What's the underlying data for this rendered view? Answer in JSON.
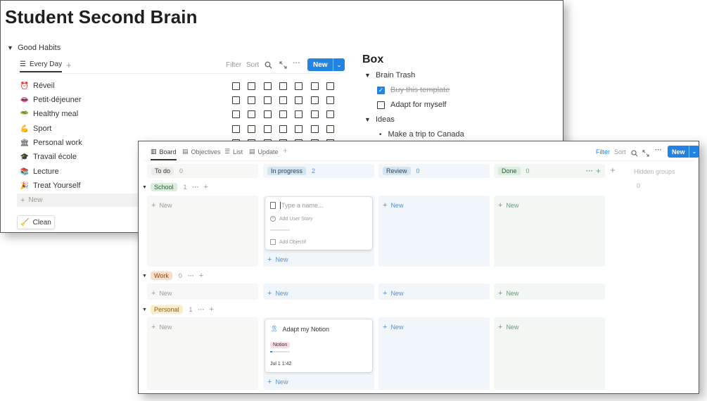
{
  "page": {
    "title": "Student Second Brain"
  },
  "habits": {
    "section_label": "Good Habits",
    "tab_label": "Every Day",
    "toolbar": {
      "filter": "Filter",
      "sort": "Sort",
      "new": "New"
    },
    "items": [
      {
        "label": "Réveil",
        "icon": "alarm-clock-icon",
        "glyph": "⏰"
      },
      {
        "label": "Petit-déjeuner",
        "icon": "lips-icon",
        "glyph": "👄"
      },
      {
        "label": "Healthy meal",
        "icon": "salad-icon",
        "glyph": "🥗"
      },
      {
        "label": "Sport",
        "icon": "flexed-biceps-icon",
        "glyph": "💪"
      },
      {
        "label": "Personal work",
        "icon": "bank-icon",
        "glyph": "🏛"
      },
      {
        "label": "Travail école",
        "icon": "graduation-cap-icon",
        "glyph": "🎓"
      },
      {
        "label": "Lecture",
        "icon": "books-icon",
        "glyph": "📚"
      },
      {
        "label": "Treat Yourself",
        "icon": "party-popper-icon",
        "glyph": "🎉"
      }
    ],
    "new_row_label": "New",
    "clean_button": "Clean"
  },
  "box": {
    "title": "Box",
    "brain_trash": {
      "label": "Brain Trash",
      "todos": [
        {
          "label": "Buy this template",
          "checked": true
        },
        {
          "label": "Adapt for myself",
          "checked": false
        }
      ]
    },
    "ideas": {
      "label": "Ideas",
      "bullets": [
        "Make a trip to Canada"
      ]
    }
  },
  "board": {
    "views": [
      {
        "label": "Board",
        "icon": "board-icon"
      },
      {
        "label": "Objectives",
        "icon": "calendar-icon"
      },
      {
        "label": "List",
        "icon": "list-icon"
      },
      {
        "label": "Update",
        "icon": "calendar-icon"
      }
    ],
    "toolbar": {
      "filter": "Filter",
      "sort": "Sort",
      "new": "New"
    },
    "columns": [
      {
        "label": "To do",
        "count": "0",
        "color": "#787774"
      },
      {
        "label": "In progress",
        "count": "2",
        "color": "#2383e2"
      },
      {
        "label": "Review",
        "count": "0",
        "color": "#2383e2"
      },
      {
        "label": "Done",
        "count": "0",
        "color": "#448361"
      }
    ],
    "hidden_groups": {
      "label": "Hidden groups",
      "count": "0"
    },
    "groups": [
      {
        "label": "School",
        "count": "1",
        "bg": "#dbeddb",
        "fg": "#2b593f"
      },
      {
        "label": "Work",
        "count": "0",
        "bg": "#fadec9",
        "fg": "#854c1d"
      },
      {
        "label": "Personal",
        "count": "1",
        "bg": "#fdecc8",
        "fg": "#89632a"
      }
    ],
    "new_label": "New",
    "draft_card": {
      "placeholder": "Type a name...",
      "add_user_story": "Add User Story",
      "add_objectif": "Add Objectif"
    },
    "personal_card": {
      "title": "Adapt my Notion",
      "tag": "Notion",
      "progress": 0.1,
      "date": "Jul 1 1:42"
    }
  }
}
